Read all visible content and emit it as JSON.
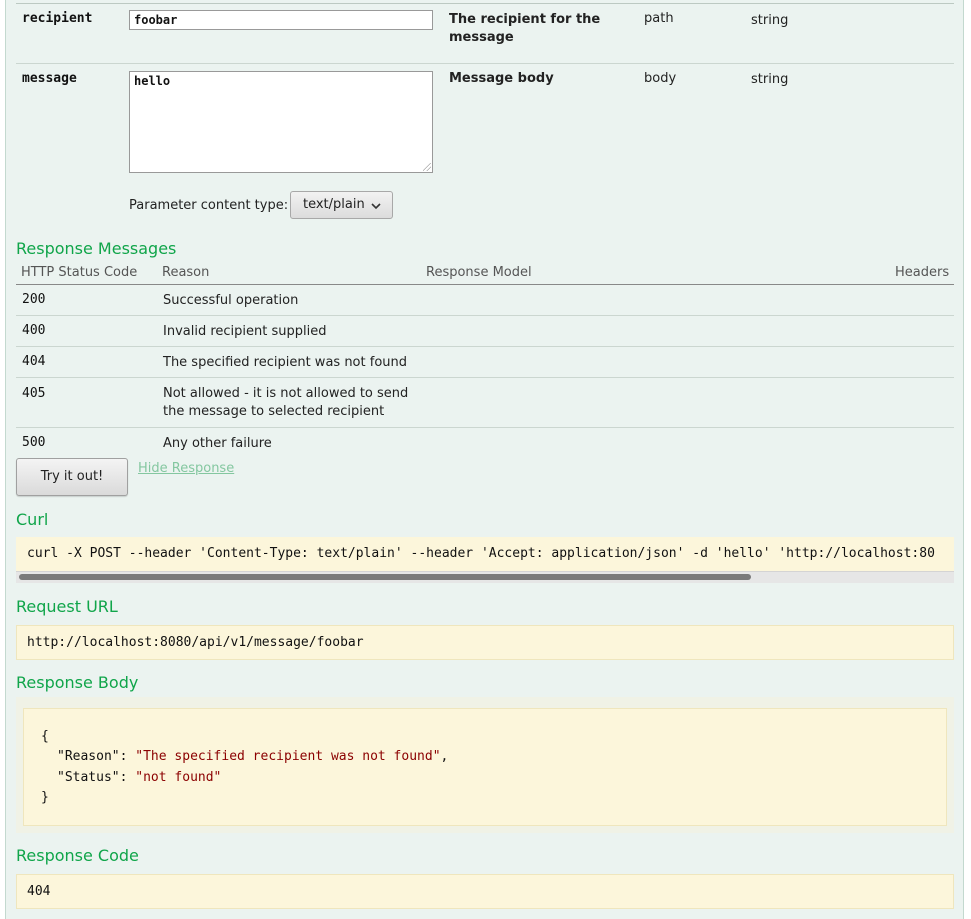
{
  "parameters": [
    {
      "name": "recipient",
      "value": "foobar",
      "description": "The recipient for the message",
      "param_type": "path",
      "data_type": "string"
    },
    {
      "name": "message",
      "value": "hello",
      "description": "Message body",
      "param_type": "body",
      "data_type": "string"
    }
  ],
  "content_type": {
    "label": "Parameter content type:",
    "selected": "text/plain"
  },
  "response_messages": {
    "title": "Response Messages",
    "headers": [
      "HTTP Status Code",
      "Reason",
      "Response Model",
      "Headers"
    ],
    "rows": [
      {
        "code": "200",
        "reason": "Successful operation"
      },
      {
        "code": "400",
        "reason": "Invalid recipient supplied"
      },
      {
        "code": "404",
        "reason": "The specified recipient was not found"
      },
      {
        "code": "405",
        "reason_line1": "Not allowed - it is not allowed to send",
        "reason_line2": "the message to selected recipient"
      },
      {
        "code": "500",
        "reason": "Any other failure"
      }
    ]
  },
  "actions": {
    "try_label": "Try it out!",
    "hide_label": "Hide Response"
  },
  "curl": {
    "title": "Curl",
    "command": "curl -X POST --header 'Content-Type: text/plain' --header 'Accept: application/json' -d 'hello' 'http://localhost:80"
  },
  "request_url": {
    "title": "Request URL",
    "value": "http://localhost:8080/api/v1/message/foobar"
  },
  "response_body": {
    "title": "Response Body",
    "open_brace": "{",
    "reason_key": "\"Reason\"",
    "reason_value": "\"The specified recipient was not found\"",
    "status_key": "\"Status\"",
    "status_value": "\"not found\"",
    "close_brace": "}"
  },
  "response_code": {
    "title": "Response Code",
    "value": "404"
  },
  "colors": {
    "accent": "#10a54a",
    "panel_bg": "#ebf3f0",
    "code_bg": "#fcf6db",
    "json_string": "#8b0000"
  }
}
